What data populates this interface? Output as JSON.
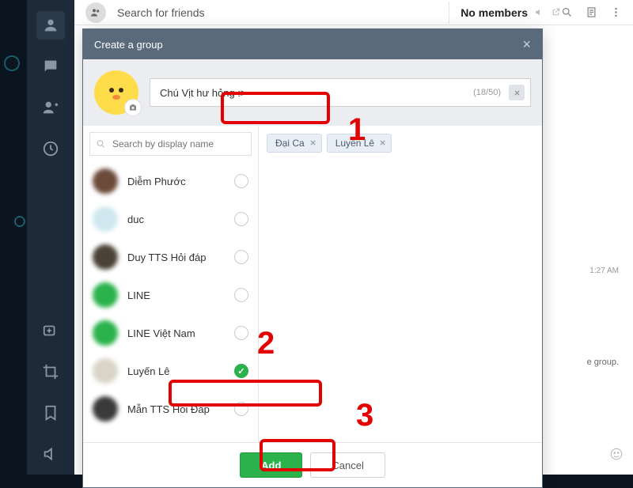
{
  "sidebar": {
    "items": [
      "home",
      "chat",
      "add-friend",
      "clock",
      "video-add",
      "crop",
      "bookmark",
      "speaker"
    ]
  },
  "top": {
    "search_placeholder": "Search for friends",
    "no_members": "No members"
  },
  "msg": {
    "timestamp": "1:27 AM",
    "hint": "e group."
  },
  "modal": {
    "title": "Create a group",
    "group_name": "Chú Vịt hư hỏng :>",
    "name_count": "(18/50)",
    "search_placeholder": "Search by display name",
    "contacts": [
      {
        "name": "Diễm Phước",
        "avatar": "#6b4a3a",
        "checked": false
      },
      {
        "name": "duc",
        "avatar": "#cfe8f0",
        "checked": false
      },
      {
        "name": "Duy TTS Hỏi đáp",
        "avatar": "#4a4236",
        "checked": false
      },
      {
        "name": "LINE",
        "avatar": "#2bb24c",
        "checked": false
      },
      {
        "name": "LINE Việt Nam",
        "avatar": "#2bb24c",
        "checked": false
      },
      {
        "name": "Luyến Lê",
        "avatar": "#d8d4c8",
        "checked": true
      },
      {
        "name": "Mẫn TTS Hỏi Đáp",
        "avatar": "#3a3a3a",
        "checked": false
      }
    ],
    "selected": [
      "Đại Ca",
      "Luyến Lê"
    ],
    "add_label": "Add",
    "cancel_label": "Cancel"
  },
  "annotations": {
    "one": "1",
    "two": "2",
    "three": "3"
  }
}
